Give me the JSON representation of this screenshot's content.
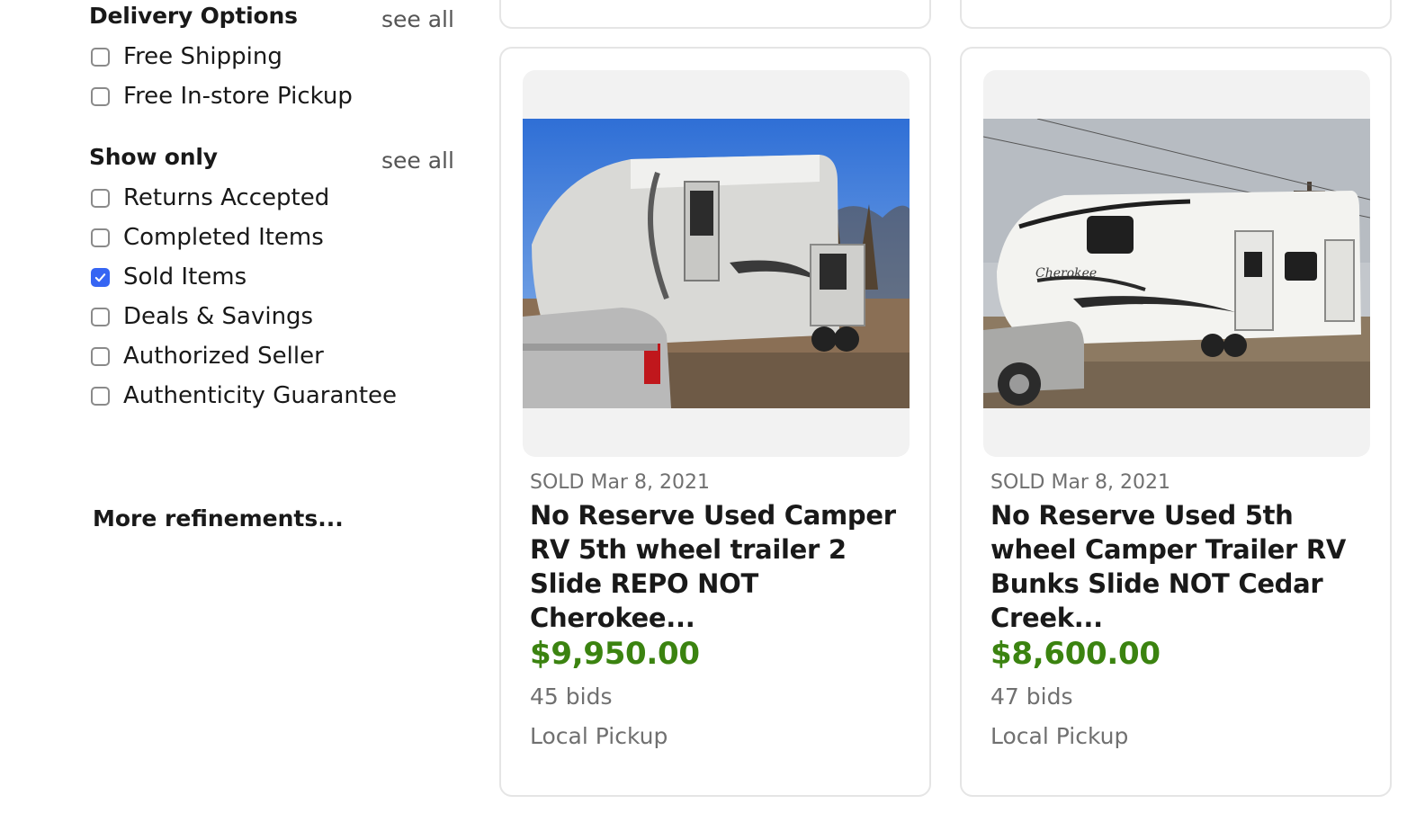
{
  "sidebar": {
    "delivery": {
      "title": "Delivery Options",
      "see_all": "see all",
      "options": [
        {
          "label": "Free Shipping",
          "checked": false
        },
        {
          "label": "Free In-store Pickup",
          "checked": false
        }
      ]
    },
    "show_only": {
      "title": "Show only",
      "see_all": "see all",
      "options": [
        {
          "label": "Returns Accepted",
          "checked": false
        },
        {
          "label": "Completed Items",
          "checked": false
        },
        {
          "label": "Sold Items",
          "checked": true
        },
        {
          "label": "Deals & Savings",
          "checked": false
        },
        {
          "label": "Authorized Seller",
          "checked": false
        },
        {
          "label": "Authenticity Guarantee",
          "checked": false
        }
      ]
    },
    "more_refinements": "More refinements..."
  },
  "listings": [
    {
      "sold_date": "SOLD Mar 8, 2021",
      "title": "No Reserve Used Camper RV 5th wheel trailer 2 Slide REPO NOT Cherokee...",
      "price": "$9,950.00",
      "bids": "45 bids",
      "delivery": "Local Pickup",
      "image_icon": "camper-rv-photo"
    },
    {
      "sold_date": "SOLD Mar 8, 2021",
      "title": "No Reserve Used 5th wheel Camper Trailer RV Bunks Slide NOT Cedar Creek...",
      "price": "$8,600.00",
      "bids": "47 bids",
      "delivery": "Local Pickup",
      "image_icon": "camper-rv-photo",
      "image_text": "Cherokee"
    }
  ],
  "colors": {
    "price_green": "#3b8310",
    "checkbox_blue": "#3665f3",
    "muted_gray": "#707070"
  }
}
